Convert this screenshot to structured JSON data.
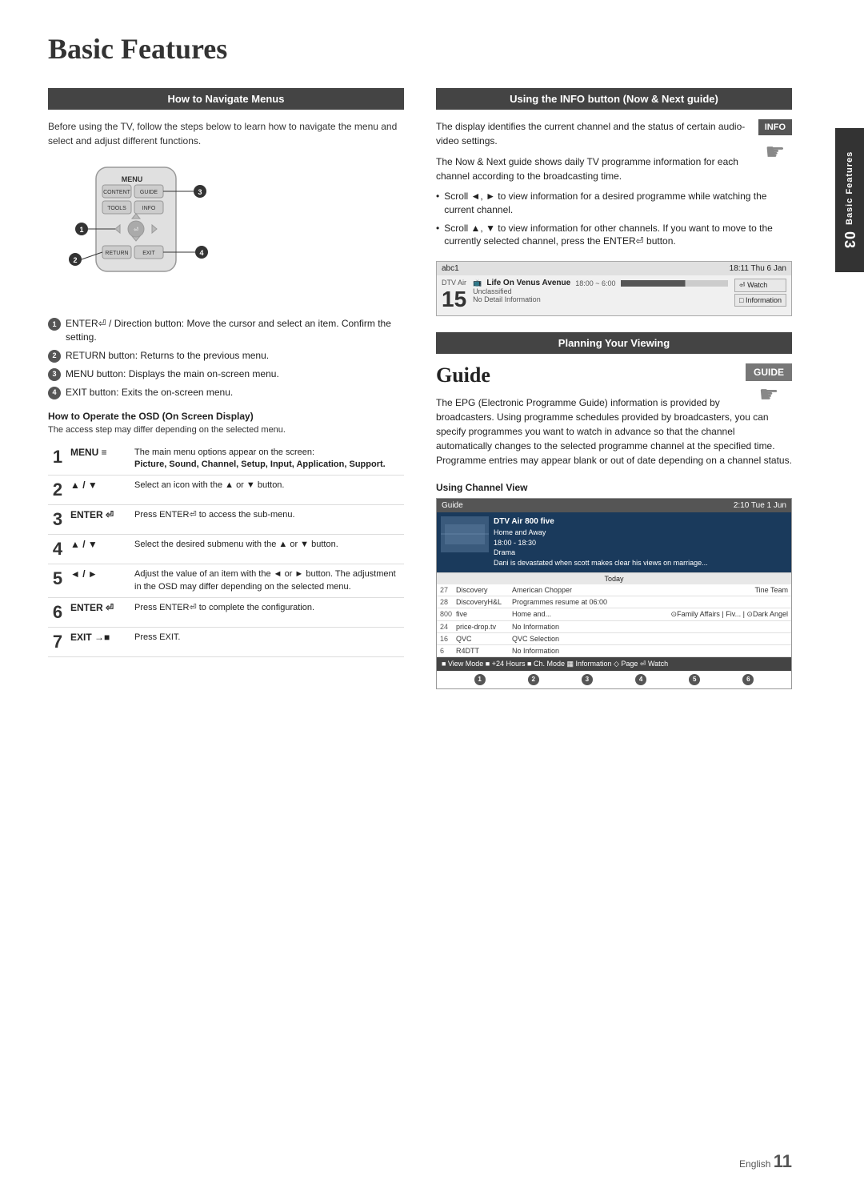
{
  "page": {
    "title": "Basic Features",
    "footer": {
      "lang": "English",
      "num": "11"
    }
  },
  "sidebar": {
    "chapter": "03",
    "label": "Basic Features"
  },
  "left_col": {
    "section_header": "How to Navigate Menus",
    "intro": "Before using the TV, follow the steps below to learn how to navigate the menu and select and adjust different functions.",
    "callouts": [
      {
        "num": "1",
        "text": "ENTER⏎ / Direction button: Move the cursor and select an item. Confirm the setting."
      },
      {
        "num": "2",
        "text": "RETURN button: Returns to the previous menu."
      },
      {
        "num": "3",
        "text": "MENU button: Displays the main on-screen menu."
      },
      {
        "num": "4",
        "text": "EXIT button: Exits the on-screen menu."
      }
    ],
    "osd_header": "How to Operate the OSD (On Screen Display)",
    "osd_note": "The access step may differ depending on the selected menu.",
    "steps": [
      {
        "num": "1",
        "key": "MENU ≡",
        "desc": "The main menu options appear on the screen:",
        "desc2": "Picture, Sound, Channel, Setup, Input, Application, Support."
      },
      {
        "num": "2",
        "key": "▲ / ▼",
        "desc": "Select an icon with the ▲ or ▼ button."
      },
      {
        "num": "3",
        "key": "ENTER ⏎",
        "desc": "Press ENTER⏎ to access the sub-menu."
      },
      {
        "num": "4",
        "key": "▲ / ▼",
        "desc": "Select the desired submenu with the ▲ or ▼ button."
      },
      {
        "num": "5",
        "key": "◄ / ►",
        "desc": "Adjust the value of an item with the ◄ or ► button. The adjustment in the OSD may differ depending on the selected menu."
      },
      {
        "num": "6",
        "key": "ENTER ⏎",
        "desc": "Press ENTER⏎ to complete the configuration."
      },
      {
        "num": "7",
        "key": "EXIT →■",
        "desc": "Press EXIT."
      }
    ]
  },
  "right_col": {
    "info_header": "Using the INFO button (Now & Next guide)",
    "info_button_label": "INFO",
    "info_texts": [
      "The display identifies the current channel and the status of certain audio-video settings.",
      "The Now & Next guide shows daily TV programme information for each channel according to the broadcasting time."
    ],
    "info_bullets": [
      "Scroll ◄, ► to view information for a desired programme while watching the current channel.",
      "Scroll ▲, ▼ to view information for other channels. If you want to move to the currently selected channel, press the ENTER⏎ button."
    ],
    "channel_box": {
      "top_left": "abc1",
      "top_right": "18:11 Thu 6 Jan",
      "ch_label": "DTV Air",
      "ch_num": "15",
      "program": "Life On Venus Avenue",
      "time": "18:00 ~ 6:00",
      "rating": "Unclassified",
      "note": "No Detail Information",
      "watch": "⏎ Watch",
      "info": "□ Information"
    },
    "planning_header": "Planning Your Viewing",
    "guide_title": "Guide",
    "guide_button_label": "GUIDE",
    "guide_texts": [
      "The EPG (Electronic Programme Guide) information is provided by broadcasters. Using programme schedules provided by broadcasters, you can specify programmes you want to watch in advance so that the channel automatically changes to the selected programme channel at the specified time. Programme entries may appear blank or out of date depending on a channel status."
    ],
    "channel_view_header": "Using  Channel View",
    "epg": {
      "header_left": "Guide",
      "header_right": "2:10 Tue 1 Jun",
      "featured": {
        "title": "DTV Air 800 five",
        "subtitle": "Home and Away",
        "time": "18:00 - 18:30",
        "genre": "Drama",
        "desc": "Dani is devastated when scott makes clear his views on marriage..."
      },
      "today_label": "Today",
      "channels": [
        {
          "num": "27",
          "name": "Discovery",
          "prog": "American Chopper",
          "extra": "Tine Team"
        },
        {
          "num": "28",
          "name": "DiscoveryH&L",
          "prog": "Programmes resume at 06:00",
          "extra": ""
        },
        {
          "num": "800",
          "name": "five",
          "prog": "Home and...",
          "extra": "⊙Family Affairs | Fiv... | ⊙Dark Angel"
        },
        {
          "num": "24",
          "name": "price-drop.tv",
          "prog": "No Information",
          "extra": ""
        },
        {
          "num": "16",
          "name": "QVC",
          "prog": "QVC Selection",
          "extra": ""
        },
        {
          "num": "6",
          "name": "R4DTT",
          "prog": "No Information",
          "extra": ""
        }
      ],
      "bottom_bar": "■ View Mode  ■ +24 Hours  ■ Ch. Mode  ▦ Information  ◇ Page  ⏎ Watch",
      "callout_nums": [
        "1",
        "2",
        "3",
        "4",
        "5",
        "6"
      ]
    }
  }
}
